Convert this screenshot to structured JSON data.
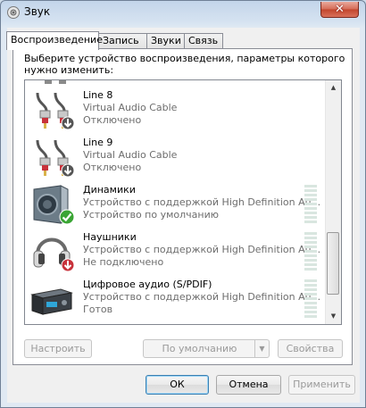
{
  "window": {
    "title": "Звук",
    "close_symbol": "✕"
  },
  "tabs": [
    {
      "label": "Воспроизведение",
      "active": true
    },
    {
      "label": "Запись",
      "active": false
    },
    {
      "label": "Звуки",
      "active": false
    },
    {
      "label": "Связь",
      "active": false
    }
  ],
  "prompt": "Выберите устройство воспроизведения, параметры которого нужно изменить:",
  "devices": [
    {
      "name": "Line 8",
      "description": "Virtual Audio Cable",
      "status": "Отключено",
      "icon": "cable-plug-icon",
      "badge": "down-arrow-badge"
    },
    {
      "name": "Line 9",
      "description": "Virtual Audio Cable",
      "status": "Отключено",
      "icon": "cable-plug-icon",
      "badge": "down-arrow-badge"
    },
    {
      "name": "Динамики",
      "description": "Устройство с поддержкой High Definition Au...",
      "status": "Устройство по умолчанию",
      "icon": "speaker-icon",
      "badge": "green-check-badge"
    },
    {
      "name": "Наушники",
      "description": "Устройство с поддержкой High Definition Au...",
      "status": "Не подключено",
      "icon": "headphones-icon",
      "badge": "red-down-arrow-badge"
    },
    {
      "name": "Цифровое аудио (S/PDIF)",
      "description": "Устройство с поддержкой High Definition Au...",
      "status": "Готов",
      "icon": "digital-audio-icon",
      "badge": ""
    }
  ],
  "buttons": {
    "configure": "Настроить",
    "set_default": "По умолчанию",
    "properties": "Свойства",
    "ok": "ОК",
    "cancel": "Отмена",
    "apply": "Применить"
  },
  "scrollbar": {
    "up": "▲",
    "down": "▼"
  },
  "split_arrow": "▼"
}
